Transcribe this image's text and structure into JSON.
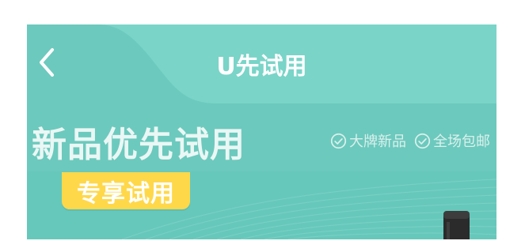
{
  "header": {
    "title": "U先试用",
    "back_icon": "chevron-left-icon"
  },
  "hero": {
    "headline": "新品优先试用",
    "tags": [
      {
        "icon": "check-circle-icon",
        "label": "大牌新品"
      },
      {
        "icon": "check-circle-icon",
        "label": "全场包邮"
      }
    ]
  },
  "badge": {
    "label": "专享试用"
  },
  "colors": {
    "primary_teal": "#6cc9bd",
    "light_teal_wave": "#7ad4c8",
    "badge_yellow": "#ffd84a",
    "white": "#ffffff"
  }
}
